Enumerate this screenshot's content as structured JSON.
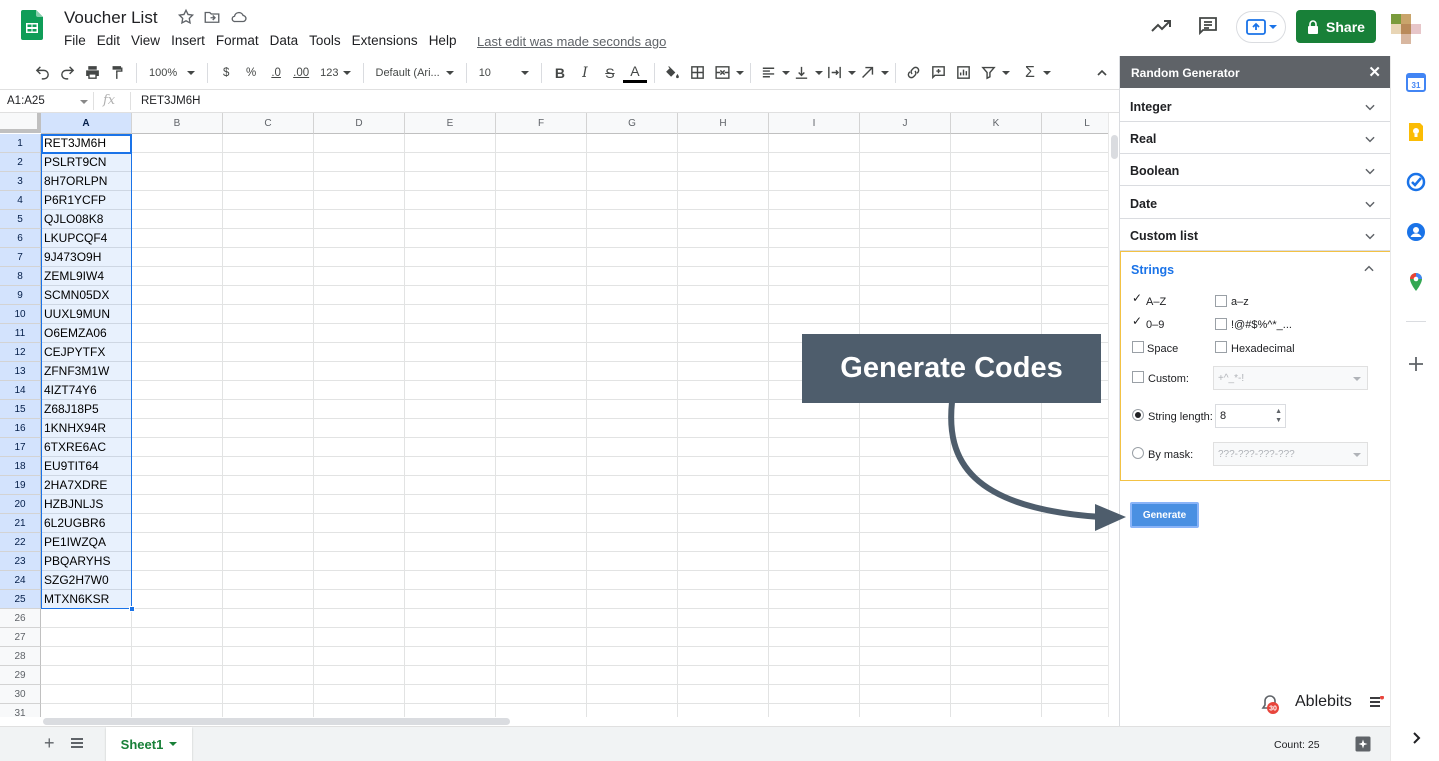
{
  "document": {
    "title": "Voucher List",
    "last_edit": "Last edit was made seconds ago"
  },
  "menu": [
    "File",
    "Edit",
    "View",
    "Insert",
    "Format",
    "Data",
    "Tools",
    "Extensions",
    "Help"
  ],
  "header": {
    "share_label": "Share"
  },
  "toolbar": {
    "zoom": "100%",
    "currency": "$",
    "percent": "%",
    "decrease_decimal": ".0",
    "increase_decimal": ".00",
    "number_format": "123",
    "font": "Default (Ari...",
    "font_size": "10",
    "bold": "B",
    "italic": "I",
    "strike": "S",
    "text_color": "A"
  },
  "formula_bar": {
    "name_box": "A1:A25",
    "fx": "fx",
    "value": "RET3JM6H"
  },
  "grid": {
    "columns": [
      "A",
      "B",
      "C",
      "D",
      "E",
      "F",
      "G",
      "H",
      "I",
      "J",
      "K",
      "L"
    ],
    "row_numbers": [
      "1",
      "2",
      "3",
      "4",
      "5",
      "6",
      "7",
      "8",
      "9",
      "10",
      "11",
      "12",
      "13",
      "14",
      "15",
      "16",
      "17",
      "18",
      "19",
      "20",
      "21",
      "22",
      "23",
      "24",
      "25",
      "26",
      "27",
      "28",
      "29",
      "30",
      "31"
    ],
    "column_a": [
      "RET3JM6H",
      "PSLRT9CN",
      "8H7ORLPN",
      "P6R1YCFP",
      "QJLO08K8",
      "LKUPCQF4",
      "9J473O9H",
      "ZEML9IW4",
      "SCMN05DX",
      "UUXL9MUN",
      "O6EMZA06",
      "CEJPYTFX",
      "ZFNF3M1W",
      "4IZT74Y6",
      "Z68J18P5",
      "1KNHX94R",
      "6TXRE6AC",
      "EU9TIT64",
      "2HA7XDRE",
      "HZBJNLJS",
      "6L2UGBR6",
      "PE1IWZQA",
      "PBQARYHS",
      "SZG2H7W0",
      "MTXN6KSR"
    ]
  },
  "bottom_bar": {
    "add_sheet": "+",
    "sheet_tab": "Sheet1",
    "count": "Count: 25"
  },
  "side_panel": {
    "title": "Random Generator",
    "close": "✕",
    "sections": [
      "Integer",
      "Real",
      "Boolean",
      "Date",
      "Custom list"
    ],
    "strings": {
      "title": "Strings",
      "opt_az_upper": "A–Z",
      "opt_az_lower": "a–z",
      "opt_digits": "0–9",
      "opt_symbols": "!@#$%^*_...",
      "opt_space": "Space",
      "opt_hex": "Hexadecimal",
      "custom_label": "Custom:",
      "custom_value": "+^_*-!",
      "length_label": "String length:",
      "length_value": "8",
      "mask_label": "By mask:",
      "mask_value": "???-???-???-???"
    },
    "generate_label": "Generate",
    "brand": "Ablebits",
    "badge": "30"
  },
  "callout": {
    "text": "Generate Codes"
  },
  "colors": {
    "share_green": "#188038",
    "selection_blue": "#1a73e8",
    "panel_header": "#5f6368",
    "strings_border": "#f3c244",
    "callout_bg": "#4e5d6c"
  }
}
